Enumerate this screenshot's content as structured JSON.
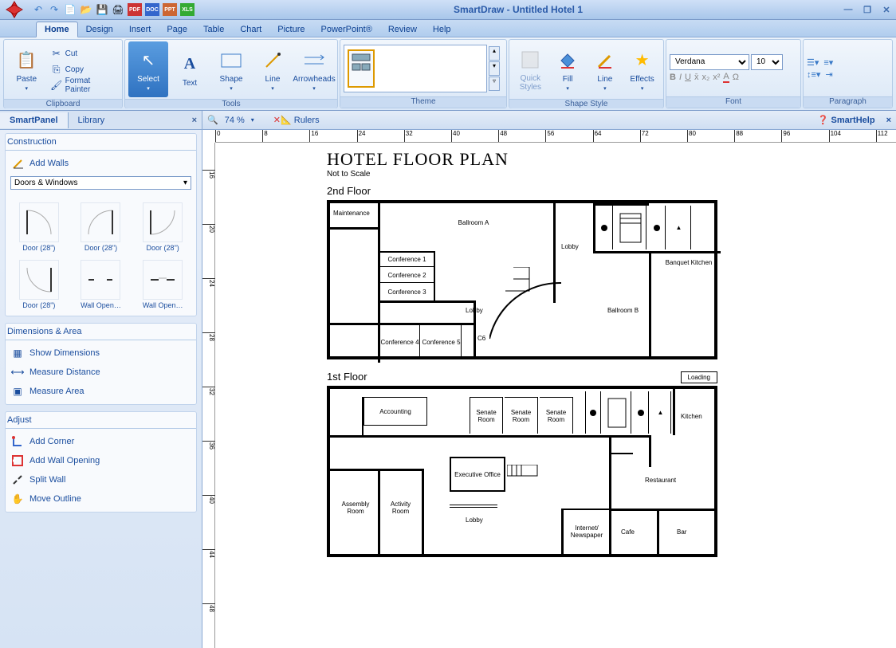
{
  "app": {
    "title": "SmartDraw - Untitled Hotel 1"
  },
  "qat": [
    "undo",
    "redo",
    "new",
    "open",
    "save",
    "print",
    "pdf",
    "doc",
    "ppt",
    "xls"
  ],
  "menu": {
    "tabs": [
      "Home",
      "Design",
      "Insert",
      "Page",
      "Table",
      "Chart",
      "Picture",
      "PowerPoint®",
      "Review",
      "Help"
    ],
    "active": 0
  },
  "ribbon": {
    "clipboard": {
      "paste": "Paste",
      "cut": "Cut",
      "copy": "Copy",
      "fp": "Format Painter",
      "label": "Clipboard"
    },
    "tools": {
      "select": "Select",
      "text": "Text",
      "shape": "Shape",
      "line": "Line",
      "arrow": "Arrowheads",
      "label": "Tools"
    },
    "theme": {
      "label": "Theme"
    },
    "style": {
      "quick": "Quick Styles",
      "fill": "Fill",
      "line": "Line",
      "effects": "Effects",
      "label": "Shape Style"
    },
    "font": {
      "name": "Verdana",
      "size": "10",
      "label": "Font"
    },
    "para": {
      "label": "Paragraph"
    }
  },
  "leftpanel": {
    "tabs": [
      "SmartPanel",
      "Library"
    ],
    "active": 0,
    "construction": {
      "header": "Construction",
      "addwalls": "Add Walls",
      "dropdown": "Doors & Windows",
      "items": [
        "Door (28\")",
        "Door (28\")",
        "Door (28\")",
        "Door (28\")",
        "Wall Open…",
        "Wall Open…"
      ]
    },
    "dim": {
      "header": "Dimensions & Area",
      "show": "Show Dimensions",
      "measure": "Measure Distance",
      "area": "Measure Area"
    },
    "adjust": {
      "header": "Adjust",
      "corner": "Add Corner",
      "opening": "Add Wall Opening",
      "split": "Split Wall",
      "move": "Move Outline"
    }
  },
  "canvas": {
    "zoom": "74 %",
    "rulers": "Rulers",
    "smarthelp": "SmartHelp"
  },
  "floorplan": {
    "title": "HOTEL FLOOR PLAN",
    "subtitle": "Not to Scale",
    "floor2": {
      "label": "2nd Floor",
      "rooms": [
        "Maintenance",
        "Ballroom A",
        "Lobby",
        "Banquet Kitchen",
        "Conference 1",
        "Conference 2",
        "Conference 3",
        "Lobby",
        "Ballroom B",
        "Conference 4",
        "Conference 5",
        "C6"
      ]
    },
    "floor1": {
      "label": "1st Floor",
      "loading": "Loading",
      "rooms": [
        "Accounting",
        "Senate Room",
        "Senate Room",
        "Senate Room",
        "Kitchen",
        "Assembly Room",
        "Activity Room",
        "Executive Office",
        "Lobby",
        "Restaurant",
        "Internet/ Newspaper",
        "Cafe",
        "Bar"
      ]
    }
  }
}
